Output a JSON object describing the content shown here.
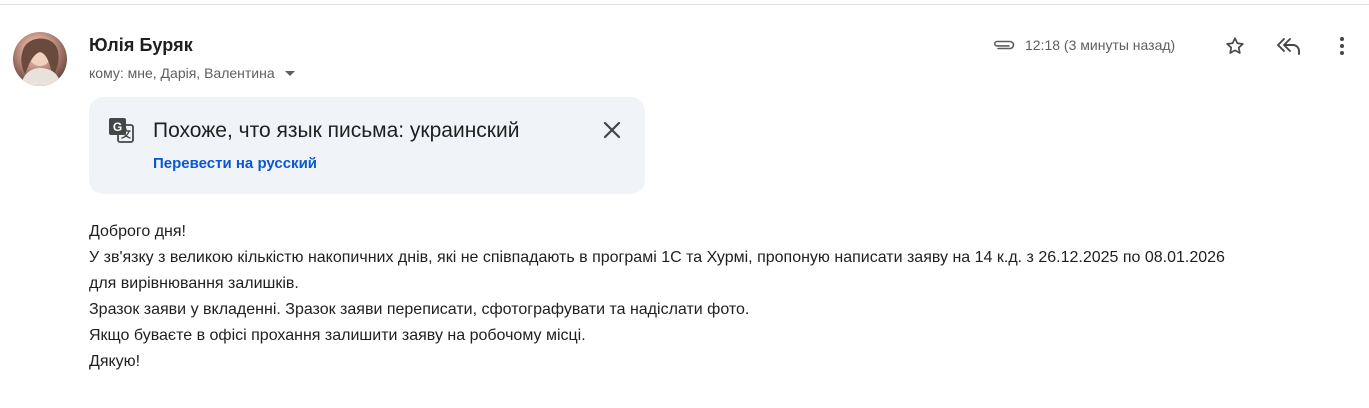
{
  "sender": {
    "name": "Юлія Буряк",
    "recipients": "кому: мне, Дарія, Валентина"
  },
  "meta": {
    "time": "12:18 (3 минуты назад)",
    "icons": [
      "paperclip-icon",
      "star-icon",
      "reply-all-icon",
      "more-vert-icon"
    ]
  },
  "translate_banner": {
    "message": "Похоже, что язык письма: украинский",
    "action": "Перевести на русский",
    "icons": [
      "translate-icon",
      "close-icon"
    ]
  },
  "body": {
    "lines": [
      "Доброго дня!",
      "У зв'язку з великою кількістю накопичних днів, які не співпадають в програмі 1С та Хурмі, пропоную написати заяву на 14 к.д. з 26.12.2025 по 08.01.2026",
      "для вирівнювання залишків.",
      "Зразок заяви у вкладенні. Зразок заяви переписати, сфотографувати та надіслати фото.",
      "Якщо буваєте в офісі прохання залишити заяву на робочому місці.",
      "Дякую!"
    ]
  },
  "colors": {
    "link": "#0b57d0",
    "banner_bg": "#f0f4f9",
    "secondary_text": "#5e5e5e",
    "primary_text": "#1f1f1f"
  }
}
